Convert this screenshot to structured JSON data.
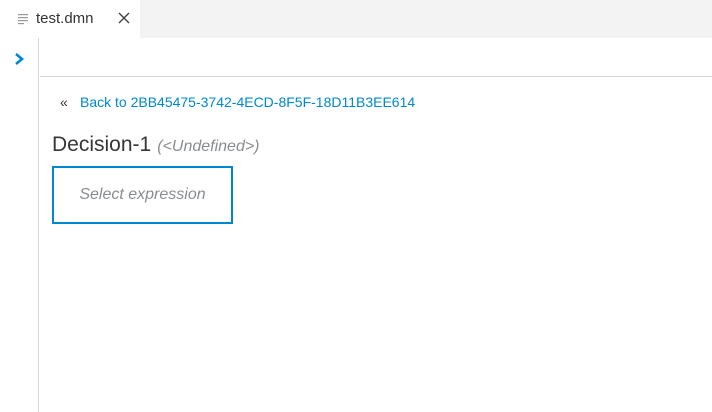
{
  "tabs": [
    {
      "label": "test.dmn",
      "icon": "file-lines-icon",
      "close_icon": "close-icon"
    }
  ],
  "rail": {
    "toggle_icon": "chevron-right-icon"
  },
  "editor": {
    "back_icon": "«",
    "back_link": "Back to 2BB45475-3742-4ECD-8F5F-18D11B3EE614",
    "decision_name": "Decision-1",
    "decision_type": "(<Undefined>)",
    "select_expression": "Select expression"
  },
  "colors": {
    "accent": "#0088ce",
    "muted_text": "#8a8d90",
    "border": "#d7d7d7",
    "tabbar_bg": "#f3f3f3"
  }
}
